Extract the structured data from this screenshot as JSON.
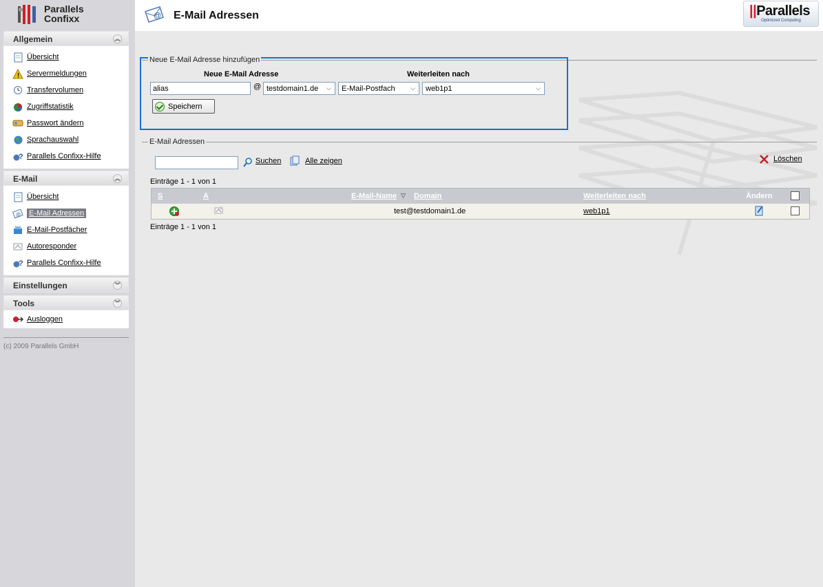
{
  "app": {
    "brand_line1": "Parallels",
    "brand_line2": "Confixx"
  },
  "sidebar": {
    "sections": [
      {
        "title": "Allgemein",
        "items": [
          "Übersicht",
          "Servermeldungen",
          "Transfervolumen",
          "Zugriffstatistik",
          "Passwort ändern",
          "Sprachauswahl",
          "Parallels Confixx-Hilfe"
        ]
      },
      {
        "title": "E-Mail",
        "items": [
          "Übersicht",
          "E-Mail Adressen",
          "E-Mail-Postfächer",
          "Autoresponder",
          "Parallels Confixx-Hilfe"
        ],
        "active": "E-Mail Adressen"
      },
      {
        "title": "Einstellungen"
      },
      {
        "title": "Tools",
        "items": [
          "Ausloggen"
        ]
      }
    ],
    "copyright": "(c) 2009 Parallels GmbH"
  },
  "header": {
    "title": "E-Mail Adressen",
    "logo_text": "Parallels",
    "logo_sub": "Optimized Computing"
  },
  "add_form": {
    "legend": "Neue E-Mail Adresse hinzufügen",
    "col_address": "Neue E-Mail Adresse",
    "col_forward": "Weiterleiten nach",
    "alias_value": "alias",
    "at": "@",
    "domain_selected": "testdomain1.de",
    "type_selected": "E-Mail-Postfach",
    "target_selected": "web1p1",
    "save_label": "Speichern"
  },
  "list": {
    "legend": "E-Mail Adressen",
    "search_value": "",
    "search_label": "Suchen",
    "show_all_label": "Alle zeigen",
    "delete_label": "Löschen",
    "entries_top": "Einträge 1 - 1 von 1",
    "entries_bottom": "Einträge 1 - 1 von 1",
    "columns": {
      "s": "S",
      "a": "A",
      "name": "E-Mail-Name",
      "domain": "Domain",
      "forward": "Weiterleiten nach",
      "edit": "Ändern"
    },
    "rows": [
      {
        "email": "test@testdomain1.de",
        "forward": "web1p1"
      }
    ]
  },
  "colors": {
    "accent_blue": "#1a6fd1",
    "sidebar_bg": "#d7d7db",
    "active_item": "#7b7b84"
  }
}
